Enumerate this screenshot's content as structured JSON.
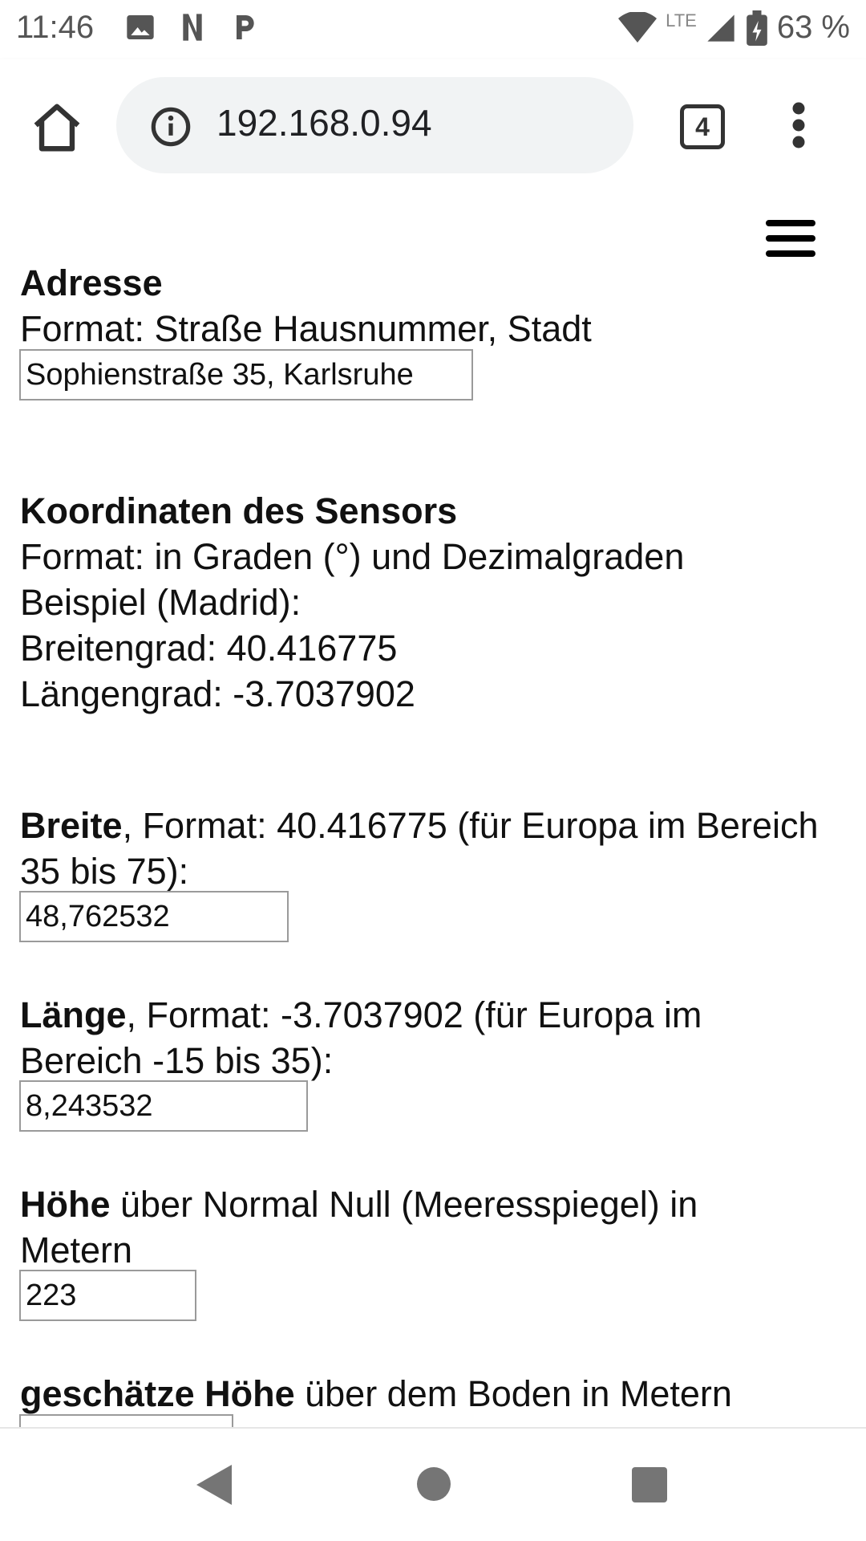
{
  "status_bar": {
    "time": "11:46",
    "notifications": [
      "image-icon",
      "netflix-icon",
      "parking-icon"
    ],
    "network_label": "LTE",
    "battery": "63 %"
  },
  "browser": {
    "url": "192.168.0.94",
    "tab_count": "4"
  },
  "form": {
    "address": {
      "heading": "Adresse",
      "format": "Format: Straße Hausnummer, Stadt",
      "value": "Sophienstraße 35, Karlsruhe"
    },
    "coordinates": {
      "heading": "Koordinaten des Sensors",
      "format": "Format: in Graden (°) und Dezimalgraden",
      "example": "Beispiel (Madrid):",
      "lat_example": "Breitengrad: 40.416775",
      "lon_example": "Längengrad: -3.7037902"
    },
    "latitude": {
      "label_bold": "Breite",
      "label_rest": ", Format: 40.416775 (für Europa im Bereich 35 bis 75):",
      "value": "48,762532"
    },
    "longitude": {
      "label_bold": "Länge",
      "label_rest": ", Format: -3.7037902 (für Europa im Bereich -15 bis 35):",
      "value": "8,243532"
    },
    "altitude": {
      "label_bold": "Höhe",
      "label_rest": " über Normal Null (Meeresspiegel) in Metern",
      "value": "223"
    },
    "height_above_ground": {
      "label_bold": "geschätze Höhe",
      "label_rest": " über dem Boden in Metern"
    }
  }
}
